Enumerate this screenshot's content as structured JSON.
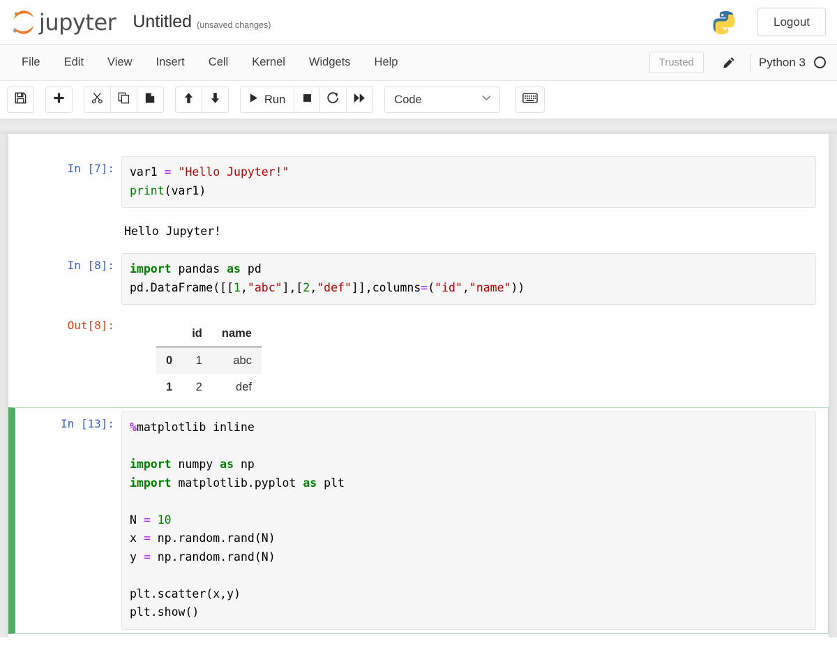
{
  "header": {
    "logo_text": "jupyter",
    "logo_icon": "jupyter-logo",
    "notebook_title": "Untitled",
    "save_status": "(unsaved changes)",
    "python_logo_icon": "python-logo",
    "logout_label": "Logout"
  },
  "menubar": {
    "items": [
      {
        "label": "File"
      },
      {
        "label": "Edit"
      },
      {
        "label": "View"
      },
      {
        "label": "Insert"
      },
      {
        "label": "Cell"
      },
      {
        "label": "Kernel"
      },
      {
        "label": "Widgets"
      },
      {
        "label": "Help"
      }
    ],
    "trusted_label": "Trusted",
    "edit_icon": "pencil-icon",
    "kernel_label": "Python 3",
    "kernel_status_icon": "kernel-idle-circle-icon"
  },
  "toolbar": {
    "save_icon": "floppy-disk-save-icon",
    "insert_icon": "plus-add-cell-icon",
    "cut_icon": "scissors-cut-icon",
    "copy_icon": "copy-icon",
    "paste_icon": "paste-icon",
    "move_up_icon": "arrow-up-icon",
    "move_down_icon": "arrow-down-icon",
    "run_icon": "play-run-icon",
    "run_label": "Run",
    "stop_icon": "stop-square-icon",
    "restart_icon": "restart-circular-arrow-icon",
    "restart_run_all_icon": "fast-forward-icon",
    "cell_type_value": "Code",
    "cell_type_chevron_icon": "chevron-down-icon",
    "command_palette_icon": "keyboard-icon"
  },
  "notebook": {
    "cells": [
      {
        "prompt": "In [7]:",
        "prompt_type": "in",
        "selected": false,
        "source_lines": [
          [
            {
              "t": "var1 ",
              "c": "tok-pl"
            },
            {
              "t": "=",
              "c": "tok-op"
            },
            {
              "t": " ",
              "c": "tok-pl"
            },
            {
              "t": "\"Hello Jupyter!\"",
              "c": "tok-str"
            }
          ],
          [
            {
              "t": "print",
              "c": "tok-bi"
            },
            {
              "t": "(var1)",
              "c": "tok-pl"
            }
          ]
        ],
        "output": {
          "kind": "text",
          "prompt": "",
          "text": "Hello Jupyter!"
        }
      },
      {
        "prompt": "In [8]:",
        "prompt_type": "in",
        "selected": false,
        "source_lines": [
          [
            {
              "t": "import",
              "c": "tok-kw"
            },
            {
              "t": " pandas ",
              "c": "tok-pl"
            },
            {
              "t": "as",
              "c": "tok-kw"
            },
            {
              "t": " pd",
              "c": "tok-pl"
            }
          ],
          [
            {
              "t": "pd.DataFrame([[",
              "c": "tok-pl"
            },
            {
              "t": "1",
              "c": "tok-num"
            },
            {
              "t": ",",
              "c": "tok-pl"
            },
            {
              "t": "\"abc\"",
              "c": "tok-str"
            },
            {
              "t": "],[",
              "c": "tok-pl"
            },
            {
              "t": "2",
              "c": "tok-num"
            },
            {
              "t": ",",
              "c": "tok-pl"
            },
            {
              "t": "\"def\"",
              "c": "tok-str"
            },
            {
              "t": "]],columns",
              "c": "tok-pl"
            },
            {
              "t": "=",
              "c": "tok-op"
            },
            {
              "t": "(",
              "c": "tok-pl"
            },
            {
              "t": "\"id\"",
              "c": "tok-str"
            },
            {
              "t": ",",
              "c": "tok-pl"
            },
            {
              "t": "\"name\"",
              "c": "tok-str"
            },
            {
              "t": "))",
              "c": "tok-pl"
            }
          ]
        ],
        "output": {
          "kind": "dataframe",
          "prompt": "Out[8]:",
          "index_header": "",
          "columns": [
            "id",
            "name"
          ],
          "rows": [
            {
              "index": "0",
              "values": [
                "1",
                "abc"
              ]
            },
            {
              "index": "1",
              "values": [
                "2",
                "def"
              ]
            }
          ]
        }
      },
      {
        "prompt": "In [13]:",
        "prompt_type": "in",
        "selected": true,
        "source_lines": [
          [
            {
              "t": "%",
              "c": "tok-mag"
            },
            {
              "t": "matplotlib inline",
              "c": "tok-pl"
            }
          ],
          [],
          [
            {
              "t": "import",
              "c": "tok-kw"
            },
            {
              "t": " numpy ",
              "c": "tok-pl"
            },
            {
              "t": "as",
              "c": "tok-kw"
            },
            {
              "t": " np",
              "c": "tok-pl"
            }
          ],
          [
            {
              "t": "import",
              "c": "tok-kw"
            },
            {
              "t": " matplotlib.pyplot ",
              "c": "tok-pl"
            },
            {
              "t": "as",
              "c": "tok-kw"
            },
            {
              "t": " plt",
              "c": "tok-pl"
            }
          ],
          [],
          [
            {
              "t": "N ",
              "c": "tok-pl"
            },
            {
              "t": "=",
              "c": "tok-op"
            },
            {
              "t": " ",
              "c": "tok-pl"
            },
            {
              "t": "10",
              "c": "tok-num"
            }
          ],
          [
            {
              "t": "x ",
              "c": "tok-pl"
            },
            {
              "t": "=",
              "c": "tok-op"
            },
            {
              "t": " np.random.rand(N)",
              "c": "tok-pl"
            }
          ],
          [
            {
              "t": "y ",
              "c": "tok-pl"
            },
            {
              "t": "=",
              "c": "tok-op"
            },
            {
              "t": " np.random.rand(N)",
              "c": "tok-pl"
            }
          ],
          [],
          [
            {
              "t": "plt.scatter(x,y)",
              "c": "tok-pl"
            }
          ],
          [
            {
              "t": "plt.show()",
              "c": "tok-pl"
            }
          ]
        ],
        "output": null
      }
    ]
  },
  "colors": {
    "accent_green": "#4caf64",
    "prompt_in": "#3b5fc0",
    "prompt_out": "#d64617",
    "string": "#bc0000",
    "keyword": "#007f00"
  }
}
